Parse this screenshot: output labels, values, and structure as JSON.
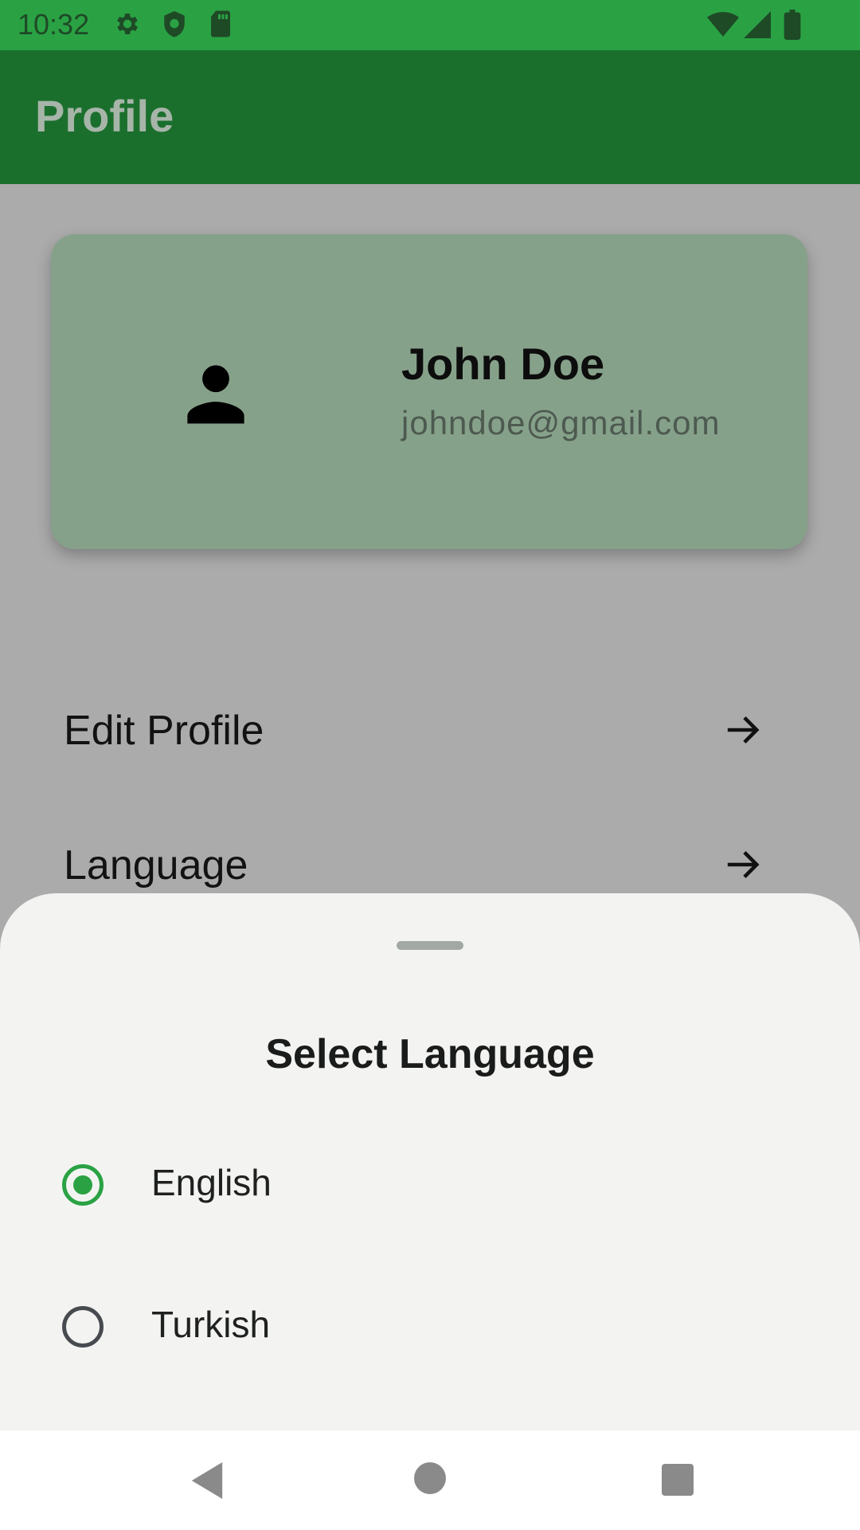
{
  "status_bar": {
    "time": "10:32",
    "left_icons": [
      "gear-icon",
      "shield-icon",
      "sd-card-icon"
    ],
    "right_icons": [
      "wifi-icon",
      "signal-icon",
      "battery-icon"
    ]
  },
  "app_bar": {
    "title": "Profile"
  },
  "profile": {
    "name": "John Doe",
    "email": "johndoe@gmail.com",
    "avatar_icon": "person-icon"
  },
  "menu": {
    "items": [
      {
        "label": "Edit Profile",
        "icon": "arrow-right-icon"
      },
      {
        "label": "Language",
        "icon": "arrow-right-icon"
      }
    ]
  },
  "language_sheet": {
    "title": "Select Language",
    "options": [
      {
        "label": "English",
        "selected": true
      },
      {
        "label": "Turkish",
        "selected": false
      }
    ]
  },
  "nav_bar": {
    "buttons": [
      "back-icon",
      "home-icon",
      "recents-icon"
    ]
  },
  "colors": {
    "status_bar": "#2aa244",
    "app_bar": "#1b6f2d",
    "accent": "#2aa244",
    "card": "#86a18a",
    "sheet": "#f3f4f2"
  }
}
